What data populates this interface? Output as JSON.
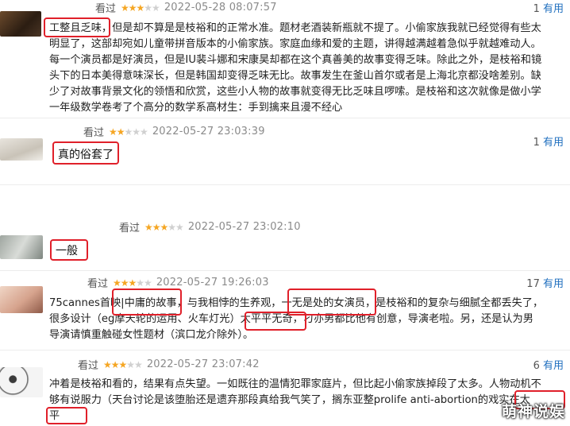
{
  "reviews": [
    {
      "rated_label": "看过",
      "stars": 3,
      "date": "2022-05-28 08:07:57",
      "votes": "1",
      "useful_label": "有用",
      "lines": [
        "工整且乏味，但是却不算是是枝裕和的正常水准。题材老酒装新瓶就不提了。小偷家族我就已经觉得有些太",
        "明显了，这部却宛如儿童带拼音版本的小偷家族。家庭血缘和爱的主题，讲得越满越着急似乎就越难动人。",
        "每一个演员都是好演员，但是IU裴斗娜和宋康昊却都在这个真善美的故事变得乏味。除此之外，是枝裕和镜",
        "头下的日本美得意味深长，但是韩国却变得乏味无比。故事发生在釜山首尔或者是上海北京都没啥差别。缺",
        "少了对故事背景文化的领悟和欣赏，这些小人物的故事就变得无比乏味且啰嗦。是枝裕和这次就像是做小学",
        "一年级数学卷考了个高分的数学系高材生：手到擒来且漫不经心"
      ]
    },
    {
      "rated_label": "看过",
      "stars": 2,
      "date": "2022-05-27 23:03:39",
      "votes": "1",
      "useful_label": "有用",
      "text": "真的俗套了"
    },
    {
      "rated_label": "看过",
      "stars": 3,
      "date": "2022-05-27 23:02:10",
      "votes": "",
      "useful_label": "",
      "text": "一般"
    },
    {
      "rated_label": "看过",
      "stars": 3,
      "date": "2022-05-27 19:26:03",
      "votes": "17",
      "useful_label": "有用",
      "lines": [
        "75cannes首映|中庸的故事，与我相悖的生养观，一无是处的女演员，是枝裕和的复杂与细腻全都丢失了，",
        "很多设计（eg摩天轮的运用、火车灯光）太平平无奇，刁亦男都比他有创意，导演老啦。另，还是认为男",
        "导演请慎重触碰女性题材（滨口龙介除外）。"
      ]
    },
    {
      "rated_label": "看过",
      "stars": 3,
      "date": "2022-05-27 23:07:42",
      "votes": "6",
      "useful_label": "有用",
      "lines": [
        "冲着是枝裕和看的，结果有点失望。一如既往的温情犯罪家庭片，但比起小偷家族掉段了太多。人物动机不",
        "够有说服力（天台讨论是该堕胎还是遗弃那段真给我气笑了，搁东亚整prolife anti-abortion的戏实在太",
        "平"
      ]
    }
  ],
  "watermark": "萌神说娱",
  "colors": {
    "highlight": "#e0202a",
    "star": "#f5a623",
    "link": "#1f6fbf"
  }
}
